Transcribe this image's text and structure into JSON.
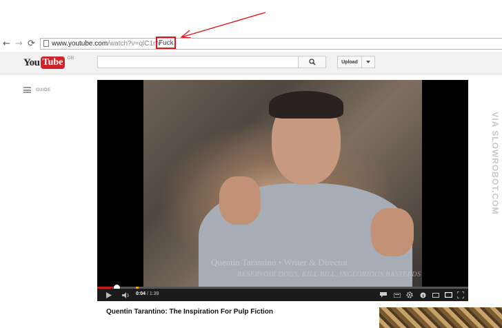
{
  "browser": {
    "url_base": "www.youtube.com",
    "url_path": "/watch?v=qlC1nV",
    "url_highlight": "Fuck",
    "back_icon": "arrow-left-icon",
    "forward_icon": "arrow-right-icon",
    "reload_icon": "reload-icon",
    "highlight_color": "#e0151a"
  },
  "header": {
    "logo_you": "You",
    "logo_tube": "Tube",
    "logo_region": "GB",
    "search_placeholder": "",
    "upload_label": "Upload"
  },
  "guide": {
    "label": "GUIDE"
  },
  "video": {
    "caption_line1": "Quentin Tarantino • Writer & Director",
    "caption_line2": "RESERVOIR DOGS, KILL BILL, INGLORIOUS BASTERDS",
    "current_time": "0:04",
    "duration": "1:39",
    "progress": 0.04,
    "title": "Quentin Tarantino: The Inspiration For Pulp Fiction"
  },
  "watermark": "VIA SLOWROBOT.COM"
}
